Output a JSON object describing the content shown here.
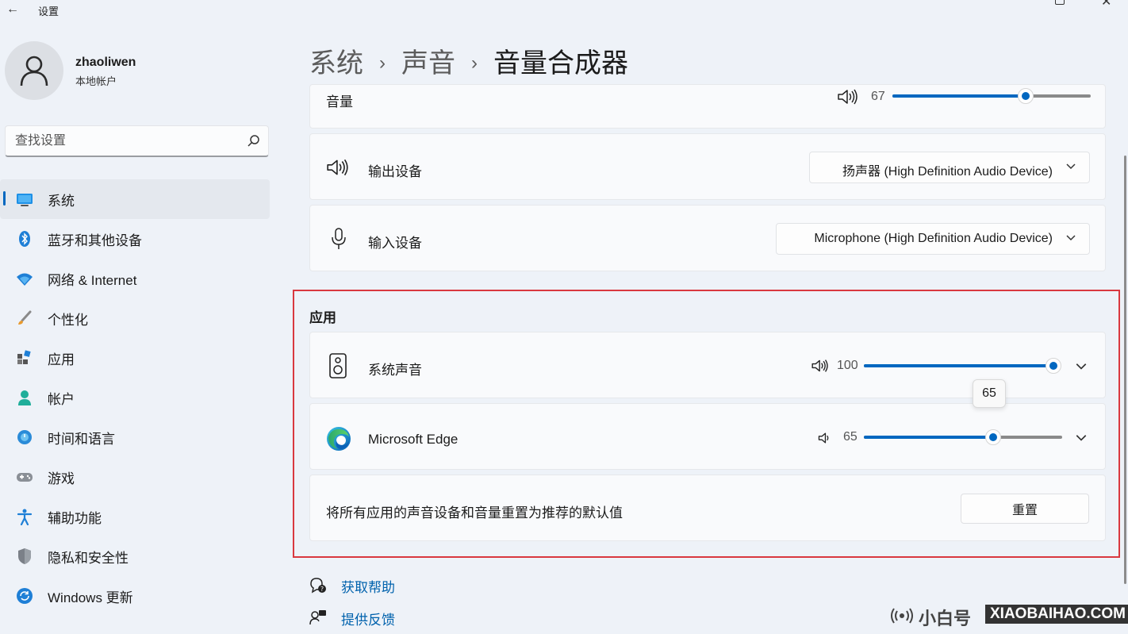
{
  "window": {
    "title": "设置",
    "back_glyph": "←",
    "close_glyph": "✕"
  },
  "user": {
    "name": "zhaoliwen",
    "account_type": "本地帐户"
  },
  "search": {
    "placeholder": "查找设置"
  },
  "sidebar": {
    "items": [
      {
        "label": "系统",
        "icon": "monitor-icon",
        "active": true
      },
      {
        "label": "蓝牙和其他设备",
        "icon": "bluetooth-icon"
      },
      {
        "label": "网络 & Internet",
        "icon": "wifi-icon"
      },
      {
        "label": "个性化",
        "icon": "brush-icon"
      },
      {
        "label": "应用",
        "icon": "apps-icon"
      },
      {
        "label": "帐户",
        "icon": "person-icon"
      },
      {
        "label": "时间和语言",
        "icon": "clock-globe-icon"
      },
      {
        "label": "游戏",
        "icon": "gamepad-icon"
      },
      {
        "label": "辅助功能",
        "icon": "accessibility-icon"
      },
      {
        "label": "隐私和安全性",
        "icon": "shield-icon"
      },
      {
        "label": "Windows 更新",
        "icon": "update-icon"
      }
    ]
  },
  "breadcrumb": {
    "level1": "系统",
    "level2": "声音",
    "current": "音量合成器",
    "separator": "›"
  },
  "master_volume": {
    "label": "音量",
    "value": "67",
    "fraction": 0.67
  },
  "output_device": {
    "label": "输出设备",
    "selected": "扬声器 (High Definition Audio Device)"
  },
  "input_device": {
    "label": "输入设备",
    "selected": "Microphone (High Definition Audio Device)"
  },
  "apps_section": {
    "title": "应用",
    "items": [
      {
        "name": "系统声音",
        "value": "100",
        "fraction": 1.0,
        "icon": "speaker-box-icon"
      },
      {
        "name": "Microsoft Edge",
        "value": "65",
        "fraction": 0.65,
        "icon": "edge-icon"
      }
    ],
    "tooltip": "65",
    "reset_text": "将所有应用的声音设备和音量重置为推荐的默认值",
    "reset_button": "重置"
  },
  "links": {
    "help": "获取帮助",
    "feedback": "提供反馈"
  },
  "watermark": {
    "cn": "小白号",
    "en": "XIAOBAIHAO.COM"
  },
  "colors": {
    "accent": "#0067c0",
    "highlight_frame": "#d9383f",
    "link": "#0062ad"
  }
}
